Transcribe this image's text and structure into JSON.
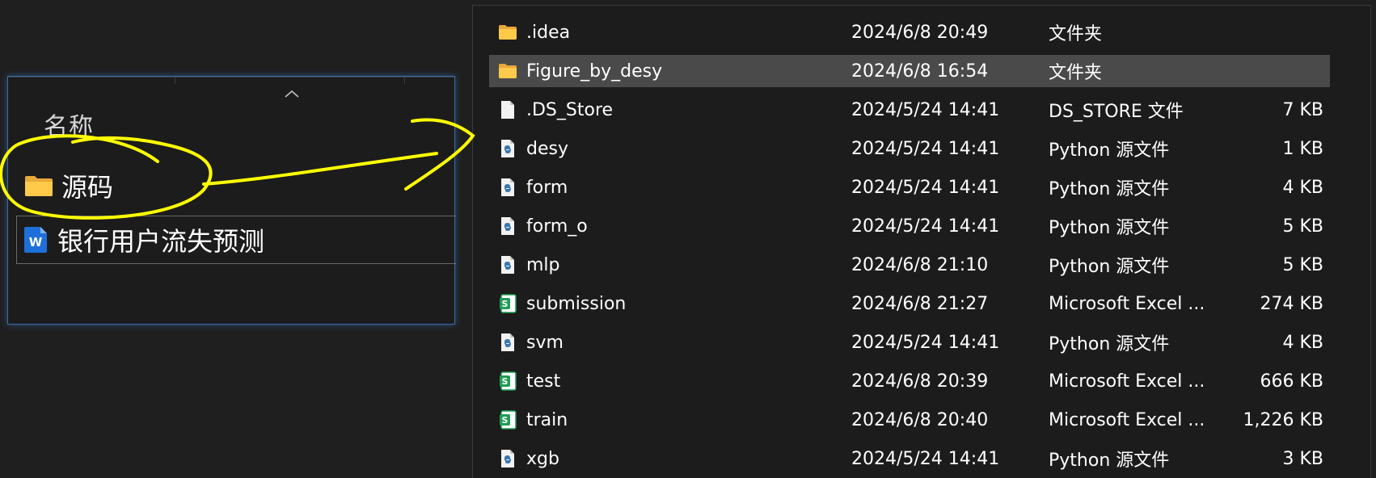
{
  "left": {
    "column_header": "名称",
    "items": [
      {
        "label": "源码",
        "icon": "folder-icon"
      },
      {
        "label": "银行用户流失预测",
        "icon": "word-doc-icon"
      }
    ]
  },
  "right": {
    "files": [
      {
        "name": ".idea",
        "date": "2024/6/8 20:49",
        "type": "文件夹",
        "size": "",
        "icon": "folder-icon"
      },
      {
        "name": "Figure_by_desy",
        "date": "2024/6/8 16:54",
        "type": "文件夹",
        "size": "",
        "icon": "folder-icon"
      },
      {
        "name": ".DS_Store",
        "date": "2024/5/24 14:41",
        "type": "DS_STORE 文件",
        "size": "7 KB",
        "icon": "blank-file-icon"
      },
      {
        "name": "desy",
        "date": "2024/5/24 14:41",
        "type": "Python 源文件",
        "size": "1 KB",
        "icon": "python-file-icon"
      },
      {
        "name": "form",
        "date": "2024/5/24 14:41",
        "type": "Python 源文件",
        "size": "4 KB",
        "icon": "python-file-icon"
      },
      {
        "name": "form_o",
        "date": "2024/5/24 14:41",
        "type": "Python 源文件",
        "size": "5 KB",
        "icon": "python-file-icon"
      },
      {
        "name": "mlp",
        "date": "2024/6/8 21:10",
        "type": "Python 源文件",
        "size": "5 KB",
        "icon": "python-file-icon"
      },
      {
        "name": "submission",
        "date": "2024/6/8 21:27",
        "type": "Microsoft Excel ...",
        "size": "274 KB",
        "icon": "excel-file-icon"
      },
      {
        "name": "svm",
        "date": "2024/5/24 14:41",
        "type": "Python 源文件",
        "size": "4 KB",
        "icon": "python-file-icon"
      },
      {
        "name": "test",
        "date": "2024/6/8 20:39",
        "type": "Microsoft Excel ...",
        "size": "666 KB",
        "icon": "excel-file-icon"
      },
      {
        "name": "train",
        "date": "2024/6/8 20:40",
        "type": "Microsoft Excel ...",
        "size": "1,226 KB",
        "icon": "excel-file-icon"
      },
      {
        "name": "xgb",
        "date": "2024/5/24 14:41",
        "type": "Python 源文件",
        "size": "3 KB",
        "icon": "python-file-icon"
      }
    ]
  },
  "colors": {
    "background": "#1f1f1f",
    "selection": "#4a4a4a",
    "annotation": "#ffff00",
    "panel_glow": "#3a6ea8"
  }
}
